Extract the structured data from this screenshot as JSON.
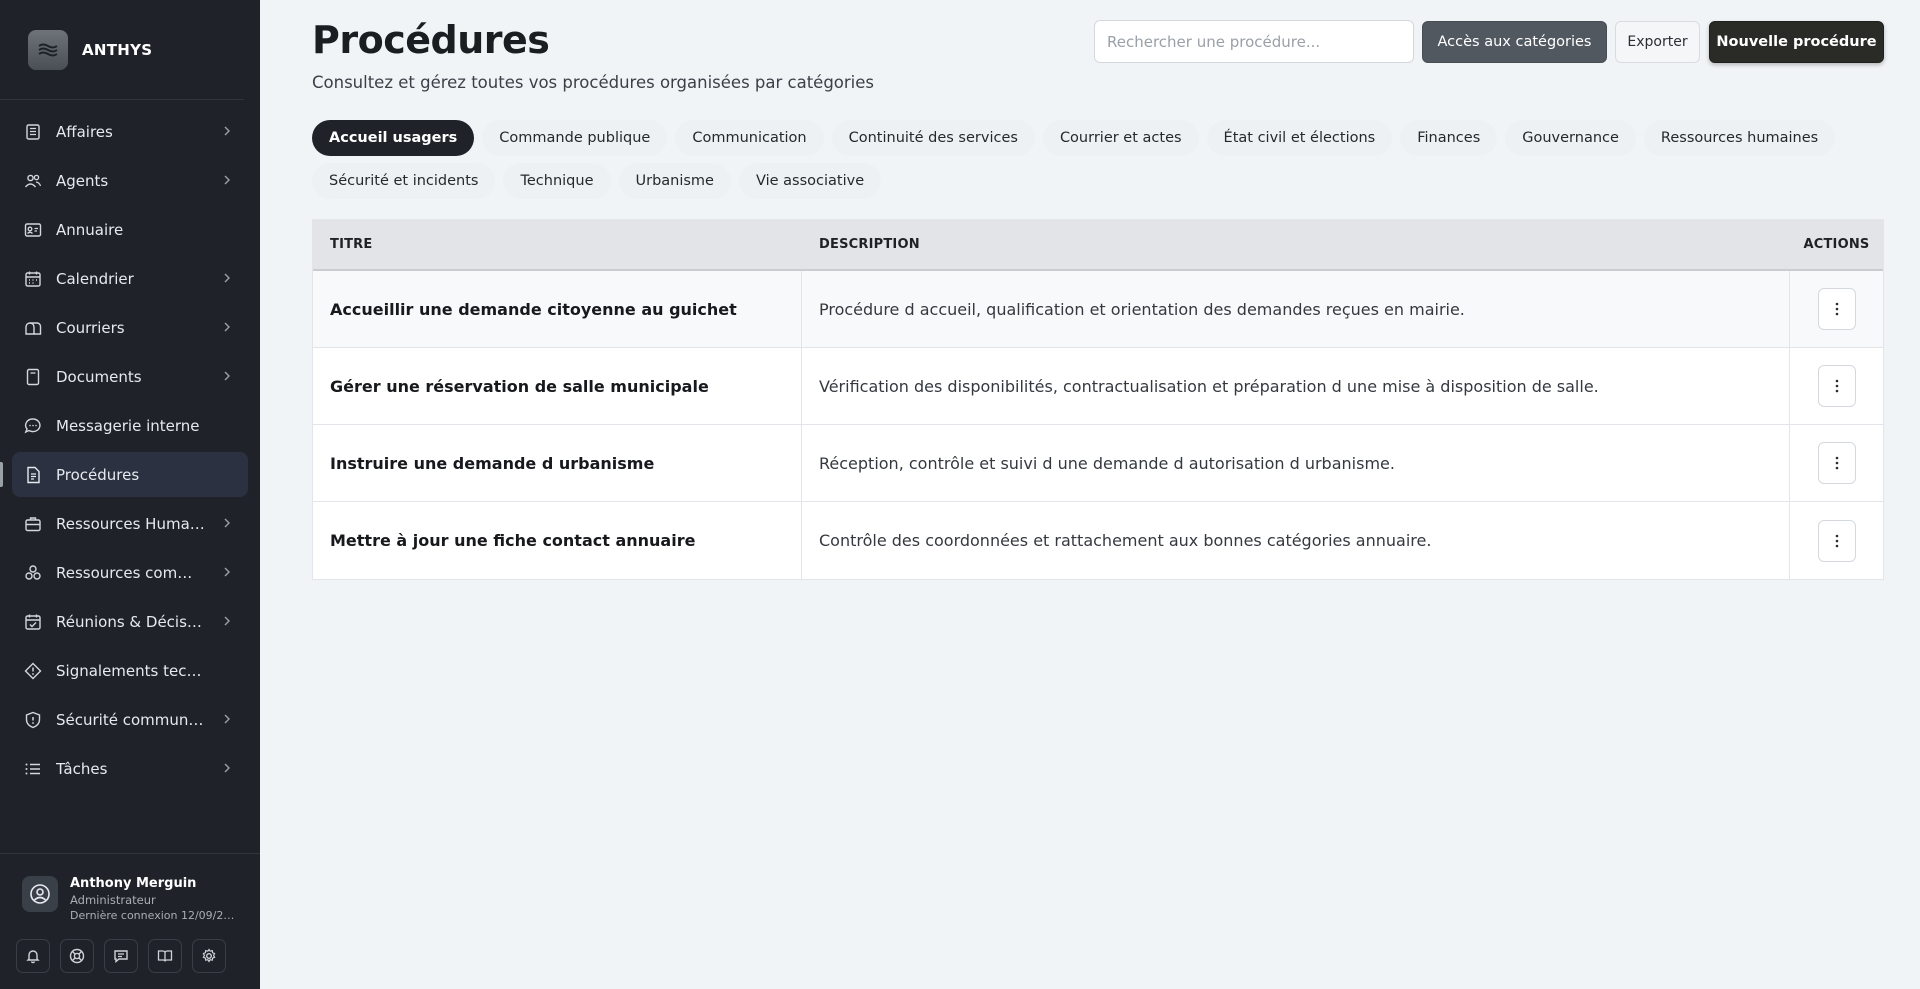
{
  "app": {
    "name": "ANTHYS"
  },
  "sidebar": {
    "items": [
      {
        "label": "Affaires",
        "icon": "building-icon",
        "has_chevron": true
      },
      {
        "label": "Agents",
        "icon": "users-icon",
        "has_chevron": true
      },
      {
        "label": "Annuaire",
        "icon": "contact-card-icon",
        "has_chevron": false
      },
      {
        "label": "Calendrier",
        "icon": "calendar-icon",
        "has_chevron": true
      },
      {
        "label": "Courriers",
        "icon": "mailbox-icon",
        "has_chevron": true
      },
      {
        "label": "Documents",
        "icon": "document-icon",
        "has_chevron": true
      },
      {
        "label": "Messagerie interne",
        "icon": "chat-bubble-icon",
        "has_chevron": false
      },
      {
        "label": "Procédures",
        "icon": "procedure-file-icon",
        "has_chevron": false,
        "active": true
      },
      {
        "label": "Ressources Humaines",
        "icon": "briefcase-icon",
        "has_chevron": true
      },
      {
        "label": "Ressources communales",
        "icon": "boxes-icon",
        "has_chevron": true
      },
      {
        "label": "Réunions & Décisions",
        "icon": "calendar-check-icon",
        "has_chevron": true
      },
      {
        "label": "Signalements techniques",
        "icon": "diamond-alert-icon",
        "has_chevron": false
      },
      {
        "label": "Sécurité communale",
        "icon": "shield-icon",
        "has_chevron": true
      },
      {
        "label": "Tâches",
        "icon": "list-icon",
        "has_chevron": true
      }
    ],
    "user": {
      "name": "Anthony Merguin",
      "role": "Administrateur",
      "last_login": "Dernière connexion 12/09/2025"
    },
    "tools": [
      "bell-icon",
      "lifebuoy-icon",
      "message-square-icon",
      "book-icon",
      "gear-icon"
    ]
  },
  "header": {
    "title": "Procédures",
    "subtitle": "Consultez et gérez toutes vos procédures organisées par catégories",
    "search_placeholder": "Rechercher une procédure...",
    "categories_button": "Accès aux catégories",
    "export_button": "Exporter",
    "new_button": "Nouvelle procédure"
  },
  "tabs": [
    {
      "label": "Accueil usagers",
      "active": true
    },
    {
      "label": "Commande publique"
    },
    {
      "label": "Communication"
    },
    {
      "label": "Continuité des services"
    },
    {
      "label": "Courrier et actes"
    },
    {
      "label": "État civil et élections"
    },
    {
      "label": "Finances"
    },
    {
      "label": "Gouvernance"
    },
    {
      "label": "Ressources humaines"
    },
    {
      "label": "Sécurité et incidents"
    },
    {
      "label": "Technique"
    },
    {
      "label": "Urbanisme"
    },
    {
      "label": "Vie associative"
    }
  ],
  "table": {
    "columns": {
      "title": "TITRE",
      "description": "DESCRIPTION",
      "actions": "ACTIONS"
    },
    "rows": [
      {
        "title": "Accueillir une demande citoyenne au guichet",
        "description": "Procédure d accueil, qualification et orientation des demandes reçues en mairie."
      },
      {
        "title": "Gérer une réservation de salle municipale",
        "description": "Vérification des disponibilités, contractualisation et préparation d une mise à disposition de salle."
      },
      {
        "title": "Instruire une demande d urbanisme",
        "description": "Réception, contrôle et suivi d une demande d autorisation d urbanisme."
      },
      {
        "title": "Mettre à jour une fiche contact annuaire",
        "description": "Contrôle des coordonnées et rattachement aux bonnes catégories annuaire."
      }
    ]
  }
}
